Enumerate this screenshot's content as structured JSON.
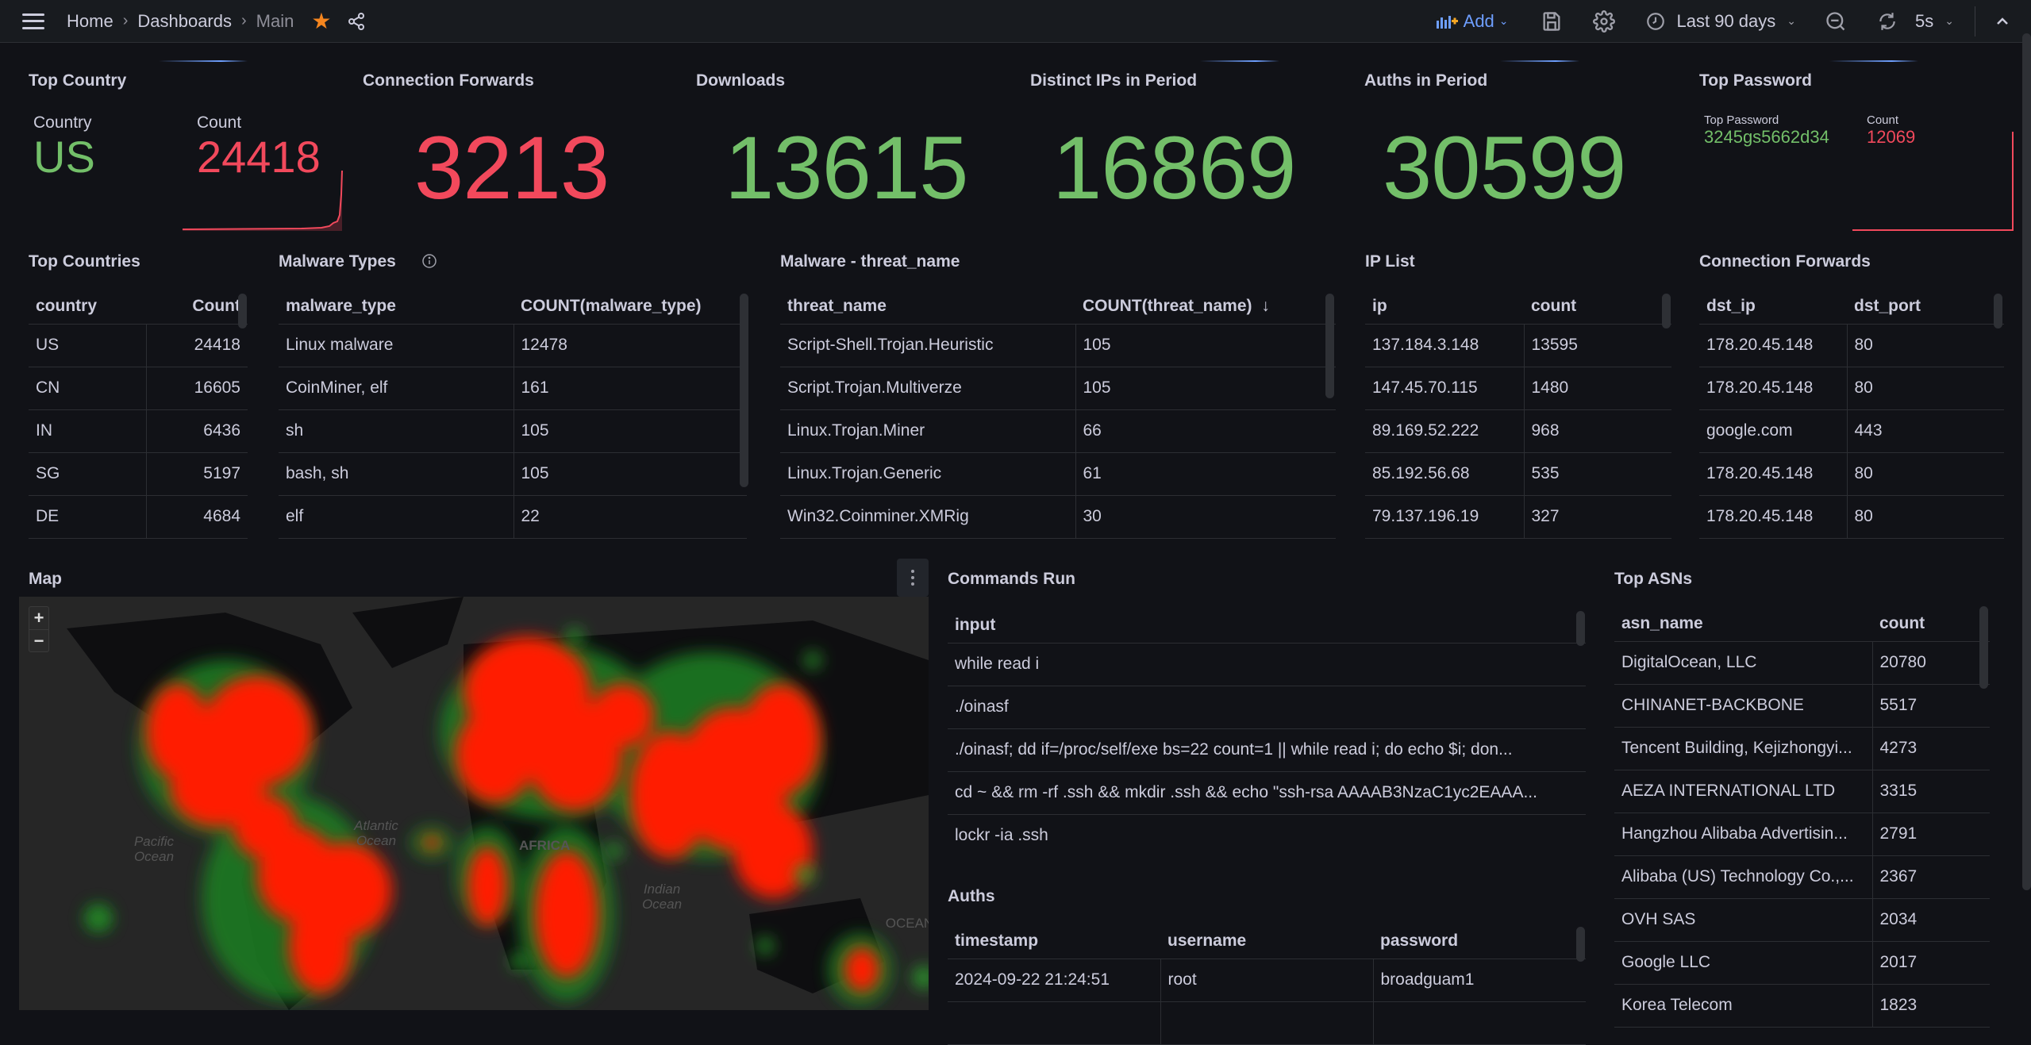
{
  "topbar": {
    "breadcrumb": [
      "Home",
      "Dashboards",
      "Main"
    ],
    "add_label": "Add",
    "time_range": "Last 90 days",
    "refresh_interval": "5s",
    "starred": true
  },
  "stats": {
    "top_country": {
      "title": "Top Country",
      "country_label": "Country",
      "country_value": "US",
      "count_label": "Count",
      "count_value": "24418"
    },
    "connection_forwards": {
      "title": "Connection Forwards",
      "value": "3213"
    },
    "downloads": {
      "title": "Downloads",
      "value": "13615"
    },
    "distinct_ips": {
      "title": "Distinct IPs in Period",
      "value": "16869"
    },
    "auths": {
      "title": "Auths in Period",
      "value": "30599"
    },
    "top_password": {
      "title": "Top Password",
      "password_label": "Top Password",
      "password_value": "3245gs5662d34",
      "count_label": "Count",
      "count_value": "12069"
    }
  },
  "colors": {
    "green": "#73bf69",
    "red": "#f2495c",
    "accent": "#6e9fff",
    "star": "#f5861f"
  },
  "tables": {
    "top_countries": {
      "title": "Top Countries",
      "columns": [
        "country",
        "Count"
      ],
      "rows": [
        [
          "US",
          "24418"
        ],
        [
          "CN",
          "16605"
        ],
        [
          "IN",
          "6436"
        ],
        [
          "SG",
          "5197"
        ],
        [
          "DE",
          "4684"
        ]
      ]
    },
    "malware_types": {
      "title": "Malware Types",
      "columns": [
        "malware_type",
        "COUNT(malware_type)"
      ],
      "rows": [
        [
          "Linux malware",
          "12478"
        ],
        [
          "CoinMiner, elf",
          "161"
        ],
        [
          "sh",
          "105"
        ],
        [
          "bash, sh",
          "105"
        ],
        [
          "elf",
          "22"
        ]
      ]
    },
    "threat_names": {
      "title": "Malware - threat_name",
      "columns": [
        "threat_name",
        "COUNT(threat_name)"
      ],
      "sort_indicator": "↓",
      "rows": [
        [
          "Script-Shell.Trojan.Heuristic",
          "105"
        ],
        [
          "Script.Trojan.Multiverze",
          "105"
        ],
        [
          "Linux.Trojan.Miner",
          "66"
        ],
        [
          "Linux.Trojan.Generic",
          "61"
        ],
        [
          "Win32.Coinminer.XMRig",
          "30"
        ]
      ]
    },
    "ip_list": {
      "title": "IP List",
      "columns": [
        "ip",
        "count"
      ],
      "rows": [
        [
          "137.184.3.148",
          "13595"
        ],
        [
          "147.45.70.115",
          "1480"
        ],
        [
          "89.169.52.222",
          "968"
        ],
        [
          "85.192.56.68",
          "535"
        ],
        [
          "79.137.196.19",
          "327"
        ]
      ]
    },
    "conn_forwards": {
      "title": "Connection Forwards",
      "columns": [
        "dst_ip",
        "dst_port"
      ],
      "rows": [
        [
          "178.20.45.148",
          "80"
        ],
        [
          "178.20.45.148",
          "80"
        ],
        [
          "google.com",
          "443"
        ],
        [
          "178.20.45.148",
          "80"
        ],
        [
          "178.20.45.148",
          "80"
        ]
      ]
    },
    "commands": {
      "title": "Commands Run",
      "columns": [
        "input"
      ],
      "rows": [
        [
          "while read i"
        ],
        [
          "./oinasf"
        ],
        [
          "./oinasf; dd if=/proc/self/exe bs=22 count=1 || while read i; do echo $i; don..."
        ],
        [
          "cd ~ && rm -rf .ssh && mkdir .ssh && echo \"ssh-rsa AAAAB3NzaC1yc2EAAA..."
        ],
        [
          "lockr -ia .ssh"
        ]
      ]
    },
    "auths": {
      "title": "Auths",
      "columns": [
        "timestamp",
        "username",
        "password"
      ],
      "rows": [
        [
          "2024-09-22 21:24:51",
          "root",
          "broadguam1"
        ]
      ]
    },
    "top_asns": {
      "title": "Top ASNs",
      "columns": [
        "asn_name",
        "count"
      ],
      "rows": [
        [
          "DigitalOcean, LLC",
          "20780"
        ],
        [
          "CHINANET-BACKBONE",
          "5517"
        ],
        [
          "Tencent Building, Kejizhongyi...",
          "4273"
        ],
        [
          "AEZA INTERNATIONAL LTD",
          "3315"
        ],
        [
          "Hangzhou Alibaba Advertisin...",
          "2791"
        ],
        [
          "Alibaba (US) Technology Co.,...",
          "2367"
        ],
        [
          "OVH SAS",
          "2034"
        ],
        [
          "Google LLC",
          "2017"
        ],
        [
          "Korea Telecom",
          "1823"
        ]
      ]
    }
  },
  "map": {
    "title": "Map",
    "zoom_in": "+",
    "zoom_out": "−",
    "labels": [
      "Pacific Ocean",
      "Atlantic Ocean",
      "AFRICA",
      "Indian Ocean",
      "OCEANIA"
    ]
  }
}
